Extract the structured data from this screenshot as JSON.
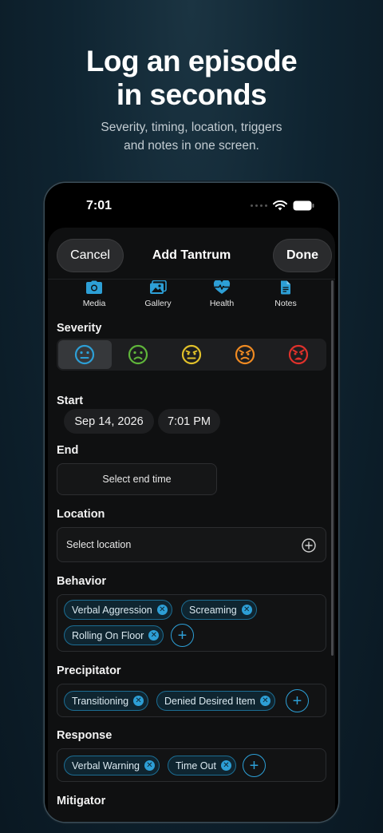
{
  "promo": {
    "headline_line1": "Log an episode",
    "headline_line2": "in seconds",
    "sub_line1": "Severity, timing, location, triggers",
    "sub_line2": "and notes in one screen."
  },
  "status": {
    "time": "7:01"
  },
  "nav": {
    "cancel": "Cancel",
    "title": "Add Tantrum",
    "done": "Done"
  },
  "quick_actions": [
    {
      "label": "Media",
      "icon": "camera-icon"
    },
    {
      "label": "Gallery",
      "icon": "gallery-icon"
    },
    {
      "label": "Health",
      "icon": "heart-pulse-icon"
    },
    {
      "label": "Notes",
      "icon": "document-icon"
    }
  ],
  "severity": {
    "label": "Severity",
    "selected_index": 0,
    "levels": [
      {
        "icon": "neutral-face-icon",
        "color": "#2d9fd6"
      },
      {
        "icon": "frown-face-icon",
        "color": "#5fb53a"
      },
      {
        "icon": "annoyed-face-icon",
        "color": "#e1c12a"
      },
      {
        "icon": "angry-face-icon",
        "color": "#ef8a22"
      },
      {
        "icon": "furious-face-icon",
        "color": "#e0312b"
      }
    ]
  },
  "start": {
    "label": "Start",
    "date": "Sep 14, 2026",
    "time": "7:01 PM"
  },
  "end": {
    "label": "End",
    "placeholder": "Select end time"
  },
  "location": {
    "label": "Location",
    "placeholder": "Select location"
  },
  "behavior": {
    "label": "Behavior",
    "tags": [
      "Verbal Aggression",
      "Screaming",
      "Rolling On Floor"
    ]
  },
  "precipitator": {
    "label": "Precipitator",
    "tags": [
      "Transitioning",
      "Denied Desired Item"
    ]
  },
  "response": {
    "label": "Response",
    "tags": [
      "Verbal Warning",
      "Time Out"
    ]
  },
  "mitigator": {
    "label": "Mitigator"
  },
  "colors": {
    "accent": "#2d9fd6",
    "background": "#0f2431",
    "sheet": "#0f1011"
  }
}
